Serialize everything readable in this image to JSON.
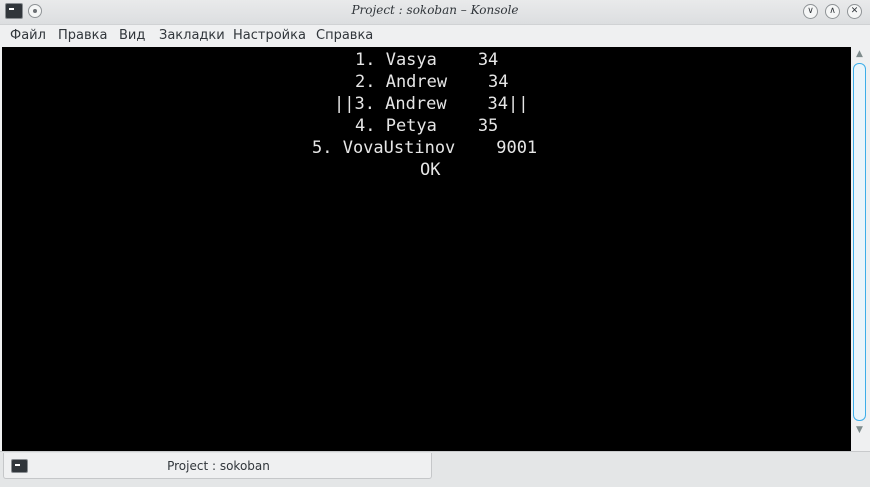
{
  "window": {
    "title": "Project : sokoban – Konsole",
    "app_icon": "terminal-icon",
    "buttons": {
      "minimize": "∨",
      "maximize": "∧",
      "close": "✕"
    }
  },
  "menubar": {
    "items": [
      "Файл",
      "Правка",
      "Вид",
      "Закладки",
      "Настройка",
      "Справка"
    ]
  },
  "terminal": {
    "lines": [
      "1. Vasya    34",
      "2. Andrew    34",
      "||3. Andrew    34||",
      "4. Petya    35",
      "5. VovaUstinov    9001",
      "OK"
    ]
  },
  "scrollbar": {
    "up_arrow": "▲",
    "down_arrow": "▼"
  },
  "tabs": [
    {
      "label": "Project : sokoban",
      "icon": "terminal-icon"
    }
  ],
  "colors": {
    "terminal_bg": "#000000",
    "terminal_fg": "#e6e6e6",
    "accent": "#3daee9"
  }
}
